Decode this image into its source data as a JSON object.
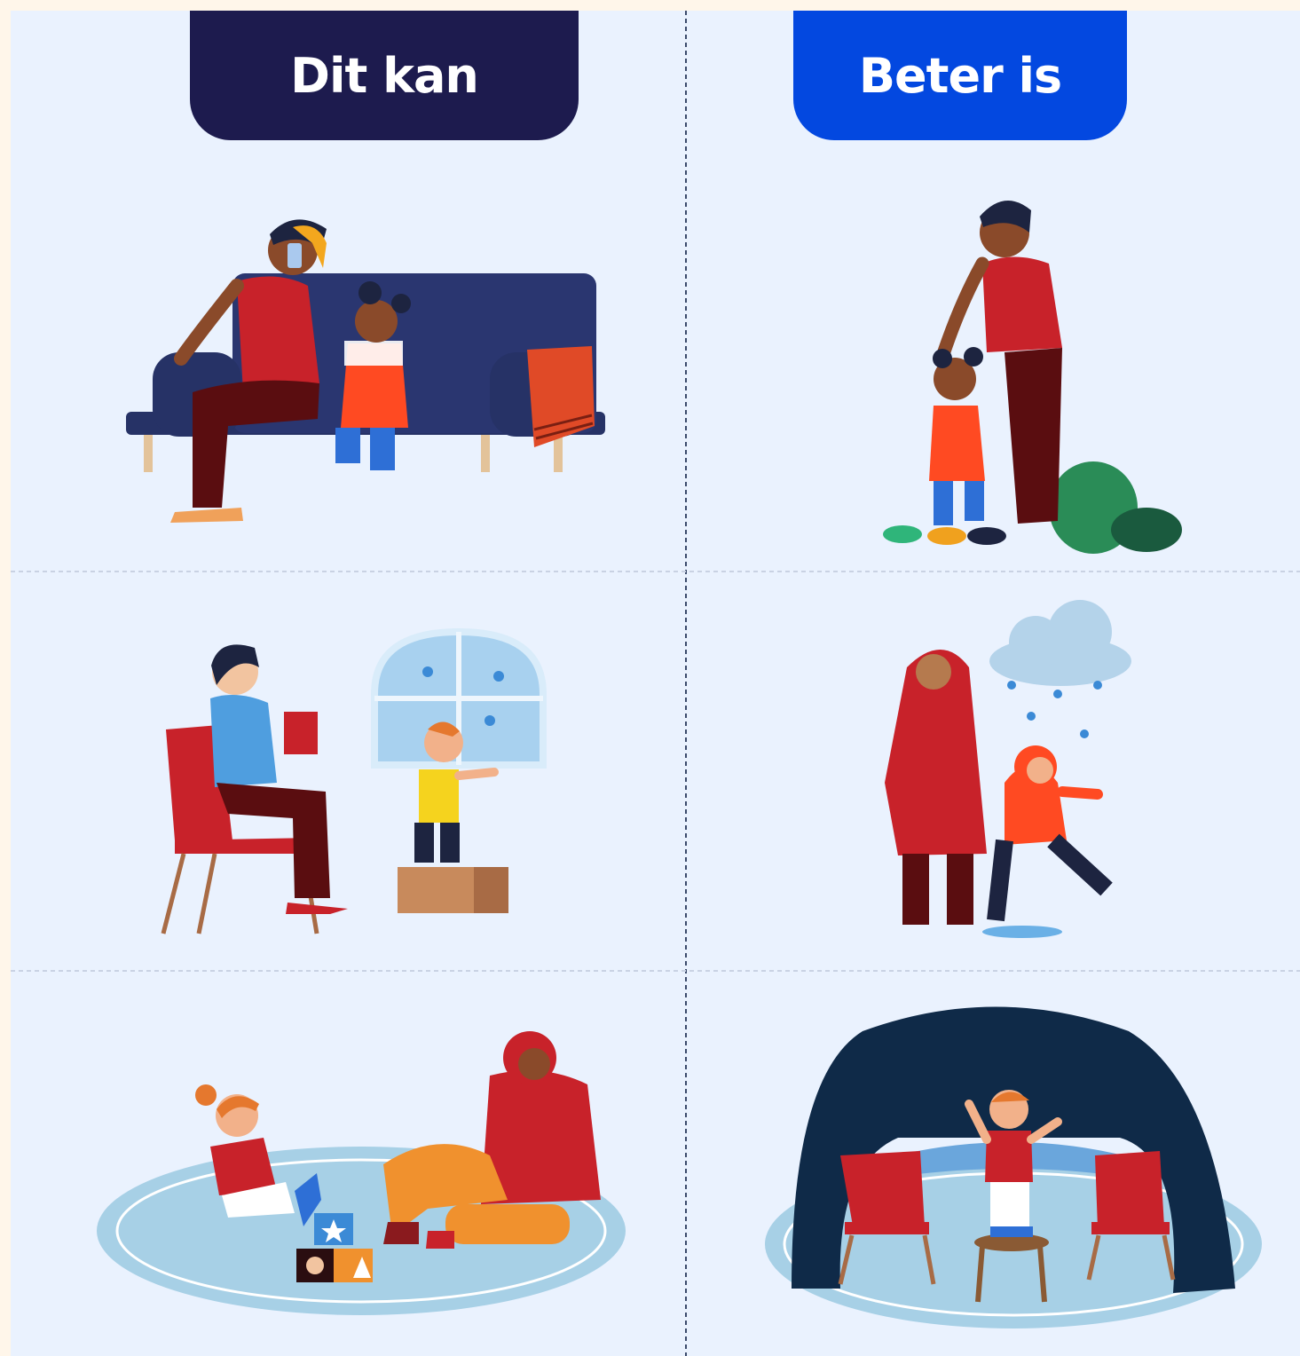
{
  "tabs": {
    "left": {
      "label": "Dit kan",
      "color": "#1d1b4e"
    },
    "right": {
      "label": "Beter is",
      "color": "#0348e0"
    }
  },
  "illustrations": {
    "left": [
      "parent-on-phone-on-sofa-with-child",
      "parent-reading-while-child-climbs-box",
      "parent-and-child-playing-on-rug"
    ],
    "right": [
      "parent-helping-child-walk-stepping-stones",
      "parent-and-child-playing-in-rain",
      "child-standing-under-blanket-fort"
    ]
  },
  "colors": {
    "panel_background": "#eaf2fe",
    "page_background": "#fff6ea",
    "divider": "#3b4a6b"
  }
}
